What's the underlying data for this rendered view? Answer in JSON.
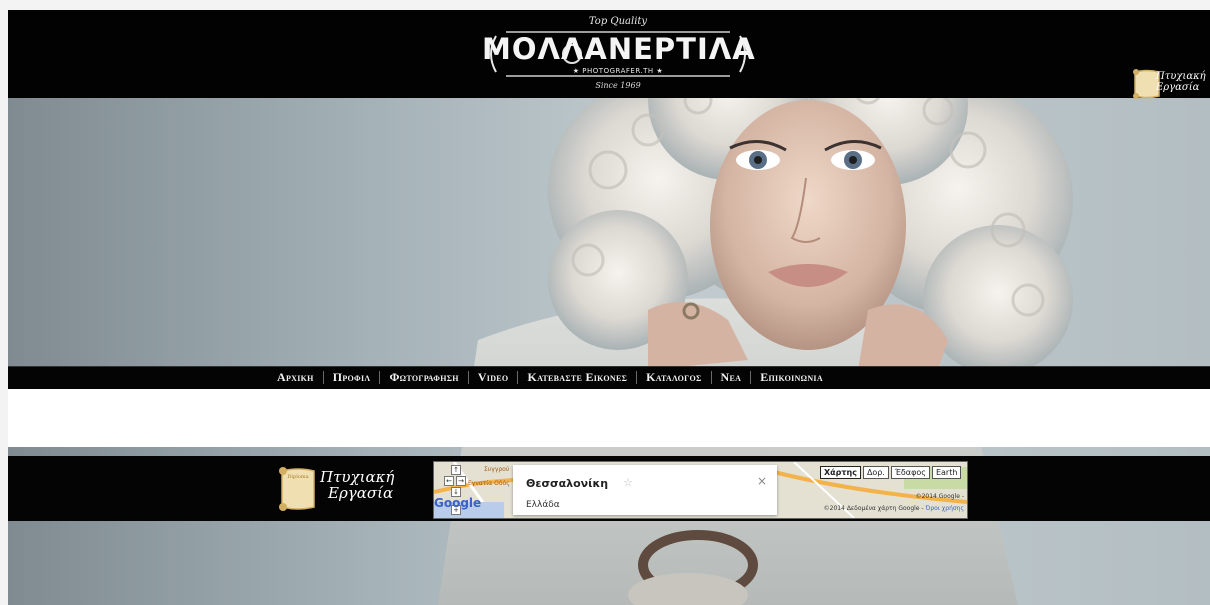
{
  "header": {
    "logo": {
      "top_line": "Top Quality",
      "title": "ΜΟΛΛΑΝΕΡΤΙΛΑ",
      "subtitle": "★ PHOTOGRAFER.TH ★",
      "since": "Since 1969"
    },
    "badge": {
      "scroll_word": "Diploma",
      "line1": "Πτυχιακή",
      "line2": "Εργασία"
    }
  },
  "nav": {
    "items": [
      {
        "label": "Αρχικη"
      },
      {
        "label": "Προφιλ"
      },
      {
        "label": "Φωτογραφηση"
      },
      {
        "label": "Video"
      },
      {
        "label": "Κατεβαστε Εικονες"
      },
      {
        "label": "Καταλογος"
      },
      {
        "label": "Νεα"
      },
      {
        "label": "Επικοινωνια"
      }
    ]
  },
  "footer": {
    "badge": {
      "scroll_word": "Diploma",
      "line1": "Πτυχιακή",
      "line2": "Εργασία"
    },
    "map": {
      "place_title": "Θεσσαλονίκη",
      "place_country": "Ελλάδα",
      "close_symbol": "×",
      "star_symbol": "☆",
      "types": [
        "Χάρτης",
        "Δορ.",
        "Έδαφος",
        "Earth"
      ],
      "active_type": "Χάρτης",
      "copyright_short": "©2014 Google -",
      "copyright_line": "©2014 Δεδομένα χάρτη Google -",
      "terms_link": "Όροι χρήσης",
      "street_labels": [
        "Εγνατία Οδός",
        "Συγγρού"
      ],
      "google_logo": "Google",
      "nav_arrows": [
        "↑",
        "←",
        "→",
        "↓",
        "+"
      ]
    }
  },
  "colors": {
    "bar": "#040404",
    "nav_text": "#f2f2f2",
    "white_band": "#ffffff"
  }
}
